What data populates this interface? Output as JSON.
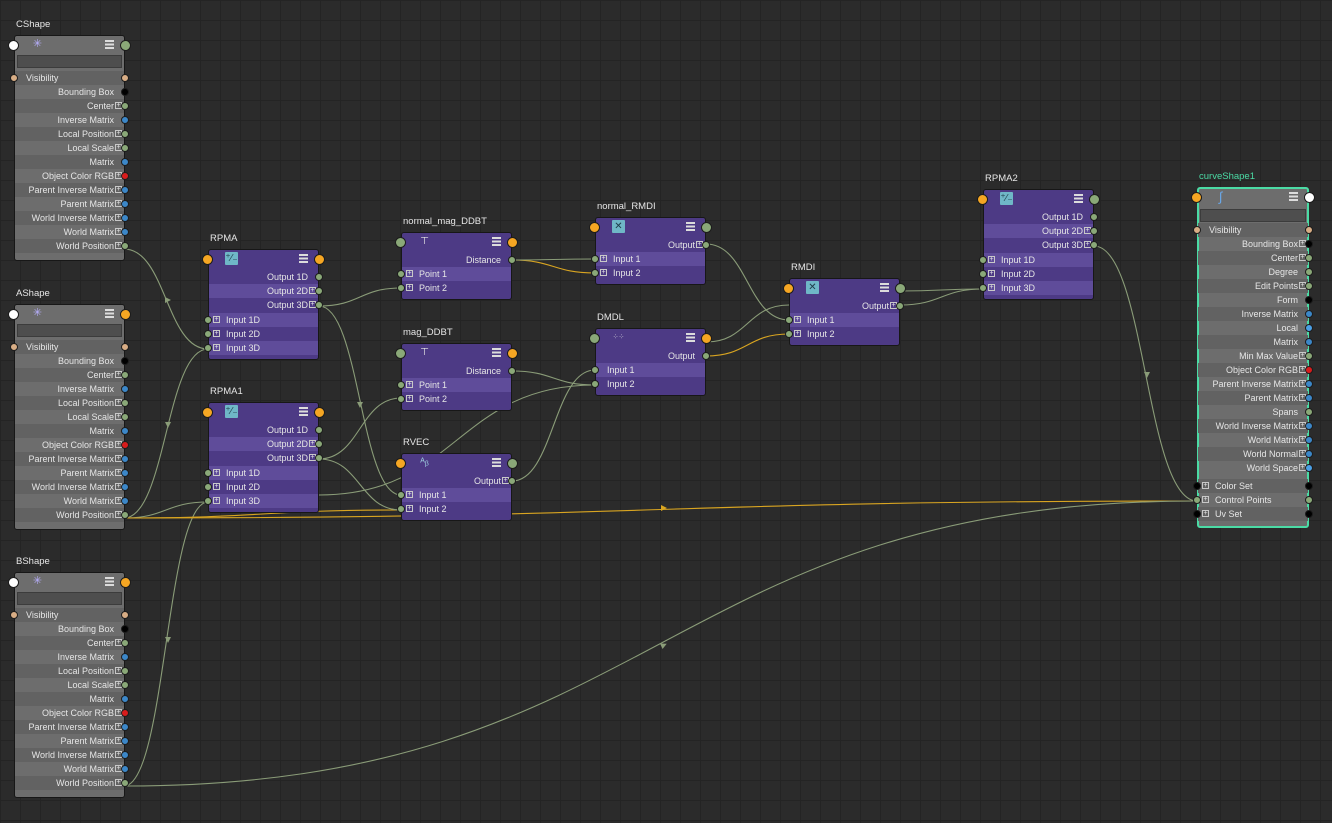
{
  "colors": {
    "background": "#2b2b2b",
    "shape_node": "#6d6d6d",
    "utility_node": "#4d3a85",
    "selected_outline": "#4bdba5",
    "wire": "#8a9c78",
    "wire_highlight": "#d9a521",
    "port_green": "#8aa878",
    "port_orange": "#f5a623",
    "port_tan": "#d8ad85",
    "port_black": "#000000",
    "port_blue": "#3c87c8",
    "port_red": "#d81c1c",
    "port_cyan": "#4ba0e6"
  },
  "nodes": {
    "cshape": {
      "title": "CShape",
      "icon": "transform-icon",
      "visibility": "Visibility",
      "attributes": [
        "Bounding Box",
        "Center",
        "Inverse Matrix",
        "Local Position",
        "Local Scale",
        "Matrix",
        "Object Color RGB",
        "Parent Inverse Matrix",
        "Parent Matrix",
        "World Inverse Matrix",
        "World Matrix",
        "World Position"
      ]
    },
    "ashape": {
      "title": "AShape",
      "icon": "transform-icon",
      "visibility": "Visibility",
      "attributes": [
        "Bounding Box",
        "Center",
        "Inverse Matrix",
        "Local Position",
        "Local Scale",
        "Matrix",
        "Object Color RGB",
        "Parent Inverse Matrix",
        "Parent Matrix",
        "World Inverse Matrix",
        "World Matrix",
        "World Position"
      ]
    },
    "bshape": {
      "title": "BShape",
      "icon": "transform-icon",
      "visibility": "Visibility",
      "attributes": [
        "Bounding Box",
        "Center",
        "Inverse Matrix",
        "Local Position",
        "Local Scale",
        "Matrix",
        "Object Color RGB",
        "Parent Inverse Matrix",
        "Parent Matrix",
        "World Inverse Matrix",
        "World Matrix",
        "World Position"
      ]
    },
    "rpma": {
      "title": "RPMA",
      "icon": "plus-minus-average-icon",
      "outputs": [
        "Output 1D",
        "Output 2D",
        "Output 3D"
      ],
      "inputs": [
        "Input 1D",
        "Input 2D",
        "Input 3D"
      ]
    },
    "rpma1": {
      "title": "RPMA1",
      "icon": "plus-minus-average-icon",
      "outputs": [
        "Output 1D",
        "Output 2D",
        "Output 3D"
      ],
      "inputs": [
        "Input 1D",
        "Input 2D",
        "Input 3D"
      ]
    },
    "rpma2": {
      "title": "RPMA2",
      "icon": "plus-minus-average-icon",
      "outputs": [
        "Output 1D",
        "Output 2D",
        "Output 3D"
      ],
      "inputs": [
        "Input 1D",
        "Input 2D",
        "Input 3D"
      ]
    },
    "normal_mag_ddbt": {
      "title": "normal_mag_DDBT",
      "icon": "distance-icon",
      "outputs": [
        "Distance"
      ],
      "inputs": [
        "Point 1",
        "Point 2"
      ]
    },
    "mag_ddbt": {
      "title": "mag_DDBT",
      "icon": "distance-icon",
      "outputs": [
        "Distance"
      ],
      "inputs": [
        "Point 1",
        "Point 2"
      ]
    },
    "normal_rmdi": {
      "title": "normal_RMDI",
      "icon": "multiply-divide-icon",
      "outputs": [
        "Output"
      ],
      "inputs": [
        "Input 1",
        "Input 2"
      ]
    },
    "dmdl": {
      "title": "DMDL",
      "icon": "mult-double-linear-icon",
      "outputs": [
        "Output"
      ],
      "inputs": [
        "Input 1",
        "Input 2"
      ]
    },
    "rmdi": {
      "title": "RMDI",
      "icon": "multiply-divide-icon",
      "outputs": [
        "Output"
      ],
      "inputs": [
        "Input 1",
        "Input 2"
      ]
    },
    "rvec": {
      "title": "RVEC",
      "icon": "vector-product-icon",
      "outputs": [
        "Output"
      ],
      "inputs": [
        "Input 1",
        "Input 2"
      ]
    },
    "curveshape1": {
      "title": "curveShape1",
      "icon": "curve-icon",
      "visibility": "Visibility",
      "attributes": [
        "Bounding Box",
        "Center",
        "Degree",
        "Edit Points",
        "Form",
        "Inverse Matrix",
        "Local",
        "Matrix",
        "Min Max Value",
        "Object Color RGB",
        "Parent Inverse Matrix",
        "Parent Matrix",
        "Spans",
        "World Inverse Matrix",
        "World Matrix",
        "World Normal",
        "World Space"
      ],
      "inputs": [
        "Color Set",
        "Control Points",
        "Uv Set"
      ]
    }
  }
}
